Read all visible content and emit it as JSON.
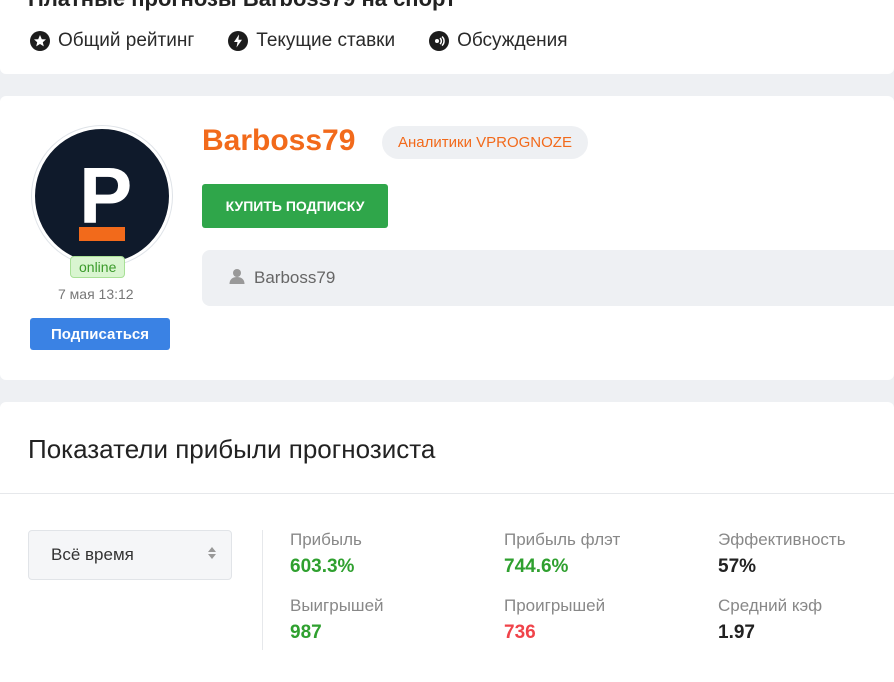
{
  "header": {
    "title": "Платные прогнозы Barboss79 на спорт",
    "nav": [
      {
        "label": "Общий рейтинг",
        "icon": "star-icon"
      },
      {
        "label": "Текущие ставки",
        "icon": "bolt-icon"
      },
      {
        "label": "Обсуждения",
        "icon": "chat-icon"
      }
    ]
  },
  "profile": {
    "username": "Barboss79",
    "role_badge": "Аналитики VPROGNOZE",
    "buy_button": "КУПИТЬ ПОДПИСКУ",
    "status": "online",
    "last_seen": "7 мая 13:12",
    "subscribe_button": "Подписаться",
    "strip_user": "Barboss79",
    "avatar_letter": "P"
  },
  "stats": {
    "title": "Показатели прибыли прогнозиста",
    "period": "Всё время",
    "items": [
      {
        "label": "Прибыль",
        "value": "603.3%"
      },
      {
        "label": "Прибыль флэт",
        "value": "744.6%"
      },
      {
        "label": "Эффективность",
        "value": "57%"
      },
      {
        "label": "Выигрышей",
        "value": "987"
      },
      {
        "label": "Проигрышей",
        "value": "736"
      },
      {
        "label": "Средний кэф",
        "value": "1.97"
      }
    ]
  },
  "colors": {
    "accent_orange": "#f26a1b",
    "buy_green": "#2fa64a",
    "subscribe_blue": "#3a82e4",
    "profit_green": "#2fa02f",
    "loss_red": "#f0434a"
  }
}
